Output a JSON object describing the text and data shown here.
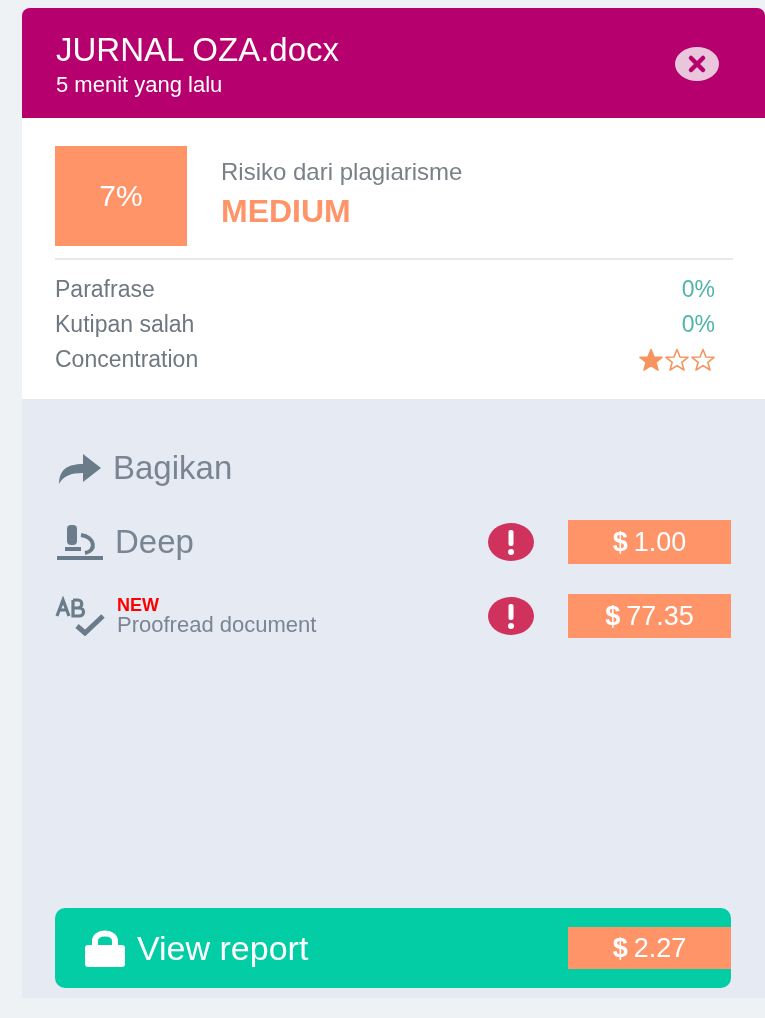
{
  "document": {
    "title": "JURNAL OZA.docx",
    "time": "5 menit yang lalu"
  },
  "risk": {
    "percent": "7%",
    "label": "Risiko dari plagiarisme",
    "level_text": "MEDIUM"
  },
  "metrics": [
    {
      "kind": "percent",
      "name": "Parafrase",
      "value": "0%"
    },
    {
      "kind": "percent",
      "name": "Kutipan salah",
      "value": "0%"
    },
    {
      "kind": "stars",
      "name": "Concentration",
      "stars": 1
    }
  ],
  "actions": [
    {
      "kind": "share",
      "label": "Bagikan"
    },
    {
      "kind": "deep",
      "label": "Deep",
      "warning": true,
      "price": "**$** 1.00"
    },
    {
      "kind": "proofread",
      "label": "Proofread document",
      "badge": "NEW",
      "warning": true,
      "price": "**$** 77.35"
    }
  ],
  "view_report": {
    "label": "View report",
    "price": "**$** 2.27"
  }
}
